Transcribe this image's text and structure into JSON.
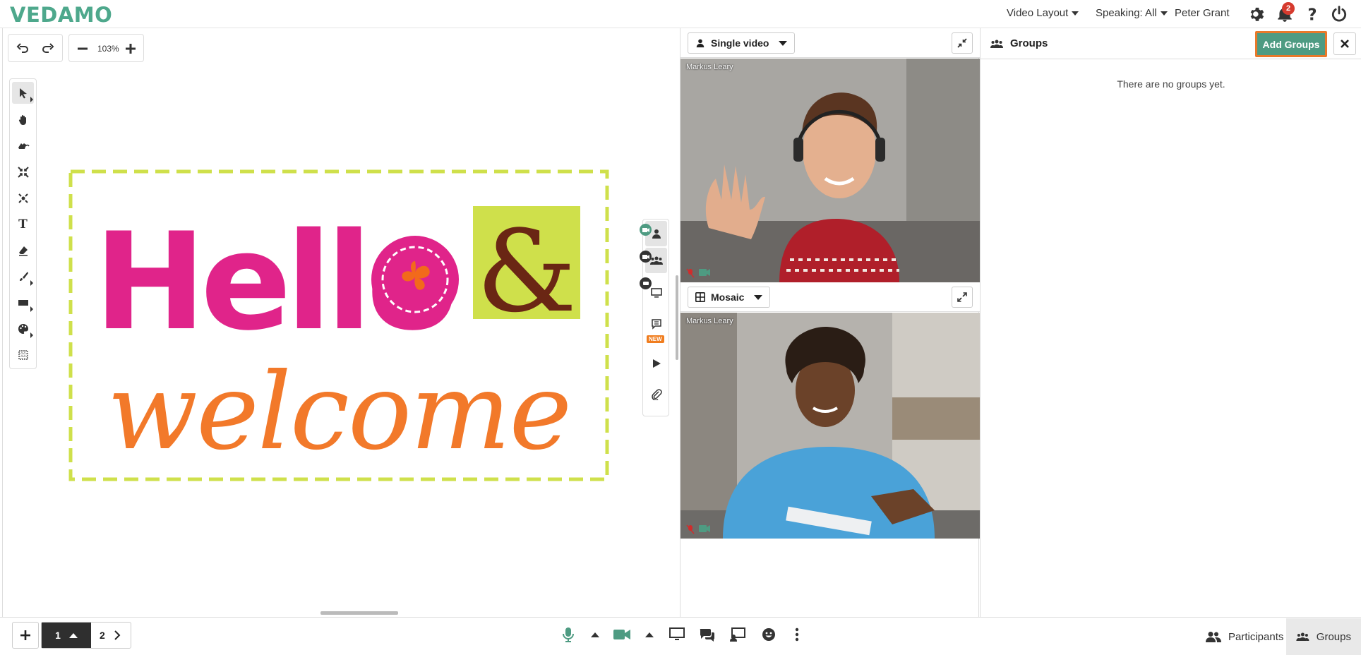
{
  "header": {
    "logo": "VEDAMO",
    "video_layout": "Video Layout",
    "speaking": "Speaking: All",
    "user_name": "Peter Grant",
    "notification_count": "2"
  },
  "whiteboard": {
    "zoom": "103%",
    "content_text_line1": "Hello",
    "content_text_ampersand": "&",
    "content_text_line2": "welcome",
    "side_new_badge": "NEW"
  },
  "video_panel": {
    "top_mode": "Single video",
    "bottom_mode": "Mosaic",
    "participant_top": "Markus Leary",
    "participant_bottom": "Markus Leary"
  },
  "groups_panel": {
    "title": "Groups",
    "add_button": "Add Groups",
    "empty_message": "There are no groups yet."
  },
  "pager": {
    "current_page": "1",
    "next_page": "2"
  },
  "bottom_tabs": {
    "participants": "Participants",
    "groups": "Groups"
  },
  "colors": {
    "brand": "#4ea88c",
    "accent_button": "#4e9b82",
    "highlight_border": "#e8792a",
    "badge": "#d63a2e"
  }
}
